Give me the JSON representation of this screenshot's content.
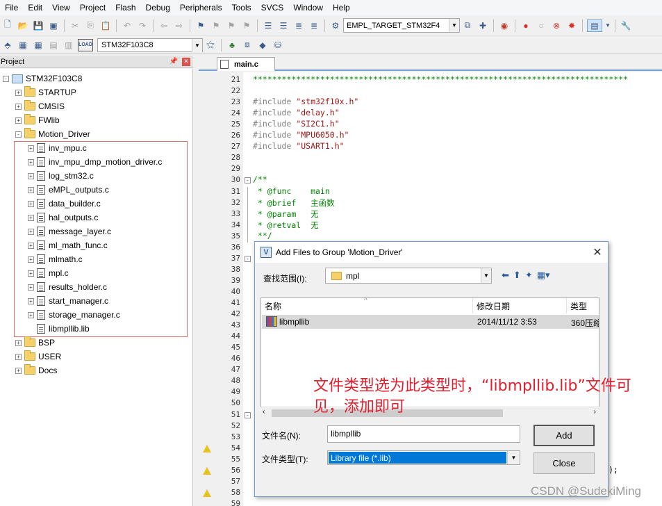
{
  "menu": [
    "File",
    "Edit",
    "View",
    "Project",
    "Flash",
    "Debug",
    "Peripherals",
    "Tools",
    "SVCS",
    "Window",
    "Help"
  ],
  "toolbar": {
    "target": "EMPL_TARGET_STM32F4",
    "device": "STM32F103C8",
    "load_label": "LOAD"
  },
  "project": {
    "panel_title": "Project",
    "root": "STM32F103C8",
    "folders_top": [
      "STARTUP",
      "CMSIS",
      "FWlib"
    ],
    "open_group": "Motion_Driver",
    "files": [
      "inv_mpu.c",
      "inv_mpu_dmp_motion_driver.c",
      "log_stm32.c",
      "eMPL_outputs.c",
      "data_builder.c",
      "hal_outputs.c",
      "message_layer.c",
      "ml_math_func.c",
      "mlmath.c",
      "mpl.c",
      "results_holder.c",
      "start_manager.c",
      "storage_manager.c",
      "libmpllib.lib"
    ],
    "folders_bottom": [
      "BSP",
      "USER",
      "Docs"
    ]
  },
  "editor": {
    "tab": "main.c",
    "lines": [
      {
        "n": "21",
        "parts": [
          {
            "t": "******************************************************************************",
            "c": "c-hash"
          }
        ]
      },
      {
        "n": "22",
        "parts": []
      },
      {
        "n": "23",
        "parts": [
          {
            "t": "#include ",
            "c": "c-pre"
          },
          {
            "t": "\"stm32f10x.h\"",
            "c": "c-str"
          }
        ]
      },
      {
        "n": "24",
        "parts": [
          {
            "t": "#include ",
            "c": "c-pre"
          },
          {
            "t": "\"delay.h\"",
            "c": "c-str"
          }
        ]
      },
      {
        "n": "25",
        "parts": [
          {
            "t": "#include ",
            "c": "c-pre"
          },
          {
            "t": "\"SI2C1.h\"",
            "c": "c-str"
          }
        ]
      },
      {
        "n": "26",
        "parts": [
          {
            "t": "#include ",
            "c": "c-pre"
          },
          {
            "t": "\"MPU6050.h\"",
            "c": "c-str"
          }
        ]
      },
      {
        "n": "27",
        "parts": [
          {
            "t": "#include ",
            "c": "c-pre"
          },
          {
            "t": "\"USART1.h\"",
            "c": "c-str"
          }
        ]
      },
      {
        "n": "28",
        "parts": []
      },
      {
        "n": "29",
        "parts": []
      },
      {
        "n": "30",
        "parts": [
          {
            "t": "/**",
            "c": "c-com"
          }
        ]
      },
      {
        "n": "31",
        "parts": [
          {
            "t": " * @func    main",
            "c": "c-com"
          }
        ]
      },
      {
        "n": "32",
        "parts": [
          {
            "t": " * @brief   主函数",
            "c": "c-com"
          }
        ]
      },
      {
        "n": "33",
        "parts": [
          {
            "t": " * @param   无",
            "c": "c-com"
          }
        ]
      },
      {
        "n": "34",
        "parts": [
          {
            "t": " * @retval  无",
            "c": "c-com"
          }
        ]
      },
      {
        "n": "35",
        "parts": [
          {
            "t": " **/",
            "c": "c-com"
          }
        ]
      },
      {
        "n": "36",
        "parts": []
      },
      {
        "n": "37",
        "parts": []
      },
      {
        "n": "38",
        "parts": []
      },
      {
        "n": "39",
        "parts": []
      },
      {
        "n": "40",
        "parts": []
      },
      {
        "n": "41",
        "parts": []
      },
      {
        "n": "42",
        "parts": []
      },
      {
        "n": "43",
        "parts": []
      },
      {
        "n": "44",
        "parts": []
      },
      {
        "n": "45",
        "parts": []
      },
      {
        "n": "46",
        "parts": []
      },
      {
        "n": "47",
        "parts": []
      },
      {
        "n": "48",
        "parts": []
      },
      {
        "n": "49",
        "parts": []
      },
      {
        "n": "50",
        "parts": []
      },
      {
        "n": "51",
        "parts": []
      },
      {
        "n": "52",
        "parts": []
      },
      {
        "n": "53",
        "parts": []
      },
      {
        "n": "54",
        "parts": []
      },
      {
        "n": "55",
        "parts": []
      },
      {
        "n": "56",
        "parts": []
      },
      {
        "n": "57",
        "parts": []
      },
      {
        "n": "58",
        "parts": []
      },
      {
        "n": "59",
        "parts": []
      }
    ],
    "line56_tail": ");"
  },
  "dialog": {
    "title": "Add Files to Group 'Motion_Driver'",
    "lookin_label": "查找范围(I):",
    "lookin_value": "mpl",
    "columns": [
      "名称",
      "修改日期",
      "类型"
    ],
    "file_row": {
      "name": "libmpllib",
      "date": "2014/11/12 3:53",
      "type": "360压缩"
    },
    "filename_label": "文件名(N):",
    "filename_value": "libmpllib",
    "filetype_label": "文件类型(T):",
    "filetype_value": "Library file (*.lib)",
    "add_button": "Add",
    "close_button": "Close"
  },
  "annotation": "文件类型选为此类型时，“libmpllib.lib”文件可见，添加即可",
  "watermark": "CSDN @SudekiMing"
}
